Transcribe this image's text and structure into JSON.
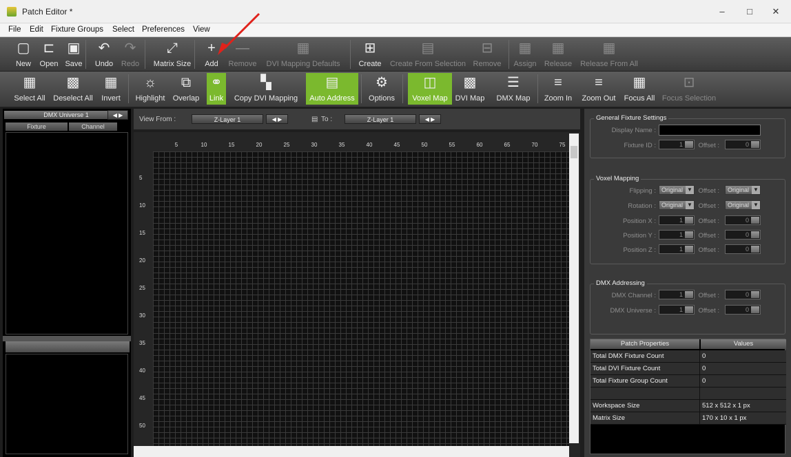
{
  "window": {
    "title": "Patch Editor *",
    "minimize": "–",
    "maximize": "□",
    "close": "✕"
  },
  "menu": [
    "File",
    "Edit",
    "Fixture Groups",
    "Select",
    "Preferences",
    "View"
  ],
  "toolbar1": [
    {
      "label": "New",
      "icon": "new-file-icon",
      "glyph": "▢",
      "disabled": false
    },
    {
      "label": "Open",
      "icon": "open-folder-icon",
      "glyph": "⊏",
      "disabled": false
    },
    {
      "label": "Save",
      "icon": "floppy-disk-icon",
      "glyph": "▣",
      "disabled": false
    },
    {
      "label": "Undo",
      "icon": "undo-arrow-icon",
      "glyph": "↶",
      "disabled": false
    },
    {
      "label": "Redo",
      "icon": "redo-arrow-icon",
      "glyph": "↷",
      "disabled": true
    },
    {
      "label": "Matrix Size",
      "icon": "matrix-size-icon",
      "glyph": "⤢",
      "disabled": false
    },
    {
      "label": "Add",
      "icon": "plus-icon",
      "glyph": "+",
      "disabled": false
    },
    {
      "label": "Remove",
      "icon": "minus-icon",
      "glyph": "—",
      "disabled": true
    },
    {
      "label": "DVI Mapping Defaults",
      "icon": "dvi-defaults-icon",
      "glyph": "▦",
      "disabled": true
    },
    {
      "label": "Create",
      "icon": "create-group-icon",
      "glyph": "⊞",
      "disabled": false
    },
    {
      "label": "Create From Selection",
      "icon": "create-from-selection-icon",
      "glyph": "▤",
      "disabled": true
    },
    {
      "label": "Remove",
      "icon": "remove-group-icon",
      "glyph": "⊟",
      "disabled": true
    },
    {
      "label": "Assign",
      "icon": "assign-icon",
      "glyph": "▦",
      "disabled": true
    },
    {
      "label": "Release",
      "icon": "release-icon",
      "glyph": "▦",
      "disabled": true
    },
    {
      "label": "Release From All",
      "icon": "release-all-icon",
      "glyph": "▦",
      "disabled": true
    }
  ],
  "toolbar2": [
    {
      "label": "Select All",
      "icon": "select-all-grid-icon",
      "glyph": "▦",
      "active": false,
      "disabled": false
    },
    {
      "label": "Deselect All",
      "icon": "deselect-all-grid-icon",
      "glyph": "▩",
      "active": false,
      "disabled": false
    },
    {
      "label": "Invert",
      "icon": "invert-grid-icon",
      "glyph": "▦",
      "active": false,
      "disabled": false
    },
    {
      "label": "Highlight",
      "icon": "highlight-bulb-icon",
      "glyph": "☼",
      "active": false,
      "disabled": false
    },
    {
      "label": "Overlap",
      "icon": "overlap-icon",
      "glyph": "⧉",
      "active": false,
      "disabled": false
    },
    {
      "label": "Link",
      "icon": "link-icon",
      "glyph": "⚭",
      "active": true,
      "disabled": false
    },
    {
      "label": "Copy DVI Mapping",
      "icon": "copy-dvi-icon",
      "glyph": "▚",
      "active": false,
      "disabled": false
    },
    {
      "label": "Auto Address",
      "icon": "auto-address-icon",
      "glyph": "▤",
      "active": true,
      "disabled": false
    },
    {
      "label": "Options",
      "icon": "gear-icon",
      "glyph": "⚙",
      "active": false,
      "disabled": false
    },
    {
      "label": "Voxel Map",
      "icon": "voxel-map-icon",
      "glyph": "◫",
      "active": true,
      "disabled": false
    },
    {
      "label": "DVI Map",
      "icon": "dvi-map-icon",
      "glyph": "▩",
      "active": false,
      "disabled": false
    },
    {
      "label": "DMX Map",
      "icon": "dmx-map-icon",
      "glyph": "☰",
      "active": false,
      "disabled": false
    },
    {
      "label": "Zoom In",
      "icon": "zoom-in-icon",
      "glyph": "≡",
      "active": false,
      "disabled": false
    },
    {
      "label": "Zoom Out",
      "icon": "zoom-out-icon",
      "glyph": "≡",
      "active": false,
      "disabled": false
    },
    {
      "label": "Focus All",
      "icon": "focus-all-icon",
      "glyph": "▦",
      "active": false,
      "disabled": false
    },
    {
      "label": "Focus Selection",
      "icon": "focus-selection-icon",
      "glyph": "⊡",
      "active": false,
      "disabled": true
    }
  ],
  "left": {
    "universe": "DMX Universe 1",
    "col_fixture": "Fixture",
    "col_channel": "Channel"
  },
  "viewbar": {
    "view_from_label": "View From :",
    "from_value": "Z-Layer 1",
    "to_label": "To :",
    "to_value": "Z-Layer 1"
  },
  "grid": {
    "x_ticks": [
      "5",
      "10",
      "15",
      "20",
      "25",
      "30",
      "35",
      "40",
      "45",
      "50",
      "55",
      "60",
      "65",
      "70",
      "75"
    ],
    "y_ticks": [
      "5",
      "10",
      "15",
      "20",
      "25",
      "30",
      "35",
      "40",
      "45",
      "50"
    ]
  },
  "general": {
    "title": "General Fixture Settings",
    "display_name_label": "Display Name :",
    "fixture_id_label": "Fixture ID :",
    "fixture_id": "1",
    "offset_label": "Offset :",
    "offset": "0"
  },
  "voxel": {
    "title": "Voxel Mapping",
    "flipping_label": "Flipping :",
    "flipping": "Original",
    "rotation_label": "Rotation :",
    "rotation": "Original",
    "offset_label": "Offset :",
    "offset_sel": "Original",
    "pos_x_label": "Position X :",
    "pos_y_label": "Position Y :",
    "pos_z_label": "Position Z :",
    "pos_value": "1",
    "offset_value": "0"
  },
  "dmx": {
    "title": "DMX Addressing",
    "channel_label": "DMX Channel :",
    "universe_label": "DMX Universe :",
    "value": "1",
    "offset_label": "Offset :",
    "offset_value": "0"
  },
  "props": {
    "col_name": "Patch Properties",
    "col_value": "Values",
    "rows": [
      {
        "k": "Total DMX Fixture Count",
        "v": "0"
      },
      {
        "k": "Total DVI Fixture Count",
        "v": "0"
      },
      {
        "k": "Total Fixture Group Count",
        "v": "0"
      },
      {
        "k": "",
        "v": ""
      },
      {
        "k": "Workspace Size",
        "v": "512 x 512 x 1 px"
      },
      {
        "k": "Matrix Size",
        "v": "170 x 10 x 1 px"
      }
    ]
  },
  "accent": "#7bb92e",
  "annotation_color": "#e0221b"
}
